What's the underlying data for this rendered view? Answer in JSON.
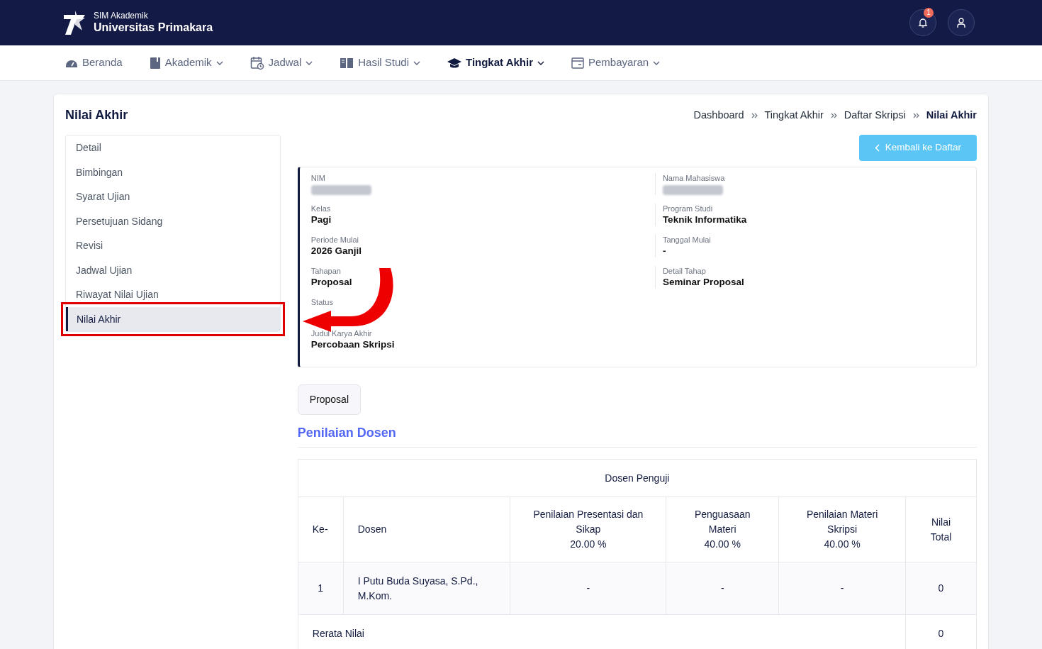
{
  "brand": {
    "subtitle": "SIM Akademik",
    "title": "Universitas Primakara"
  },
  "notifications": {
    "count": "1"
  },
  "menu": [
    {
      "label": "Beranda",
      "dropdown": false,
      "selected": false
    },
    {
      "label": "Akademik",
      "dropdown": true,
      "selected": false
    },
    {
      "label": "Jadwal",
      "dropdown": true,
      "selected": false
    },
    {
      "label": "Hasil Studi",
      "dropdown": true,
      "selected": false
    },
    {
      "label": "Tingkat Akhir",
      "dropdown": true,
      "selected": true
    },
    {
      "label": "Pembayaran",
      "dropdown": true,
      "selected": false
    }
  ],
  "page_title": "Nilai Akhir",
  "breadcrumb": [
    "Dashboard",
    "Tingkat Akhir",
    "Daftar Skripsi",
    "Nilai Akhir"
  ],
  "sidebar": {
    "items": [
      {
        "label": "Detail",
        "selected": false,
        "highlighted": false
      },
      {
        "label": "Bimbingan",
        "selected": false,
        "highlighted": false
      },
      {
        "label": "Syarat Ujian",
        "selected": false,
        "highlighted": false
      },
      {
        "label": "Persetujuan Sidang",
        "selected": false,
        "highlighted": false
      },
      {
        "label": "Revisi",
        "selected": false,
        "highlighted": false
      },
      {
        "label": "Jadwal Ujian",
        "selected": false,
        "highlighted": false
      },
      {
        "label": "Riwayat Nilai Ujian",
        "selected": false,
        "highlighted": false
      },
      {
        "label": "Nilai Akhir",
        "selected": true,
        "highlighted": true
      }
    ]
  },
  "back_button": "Kembali ke Daftar",
  "details": {
    "left": [
      {
        "label": "NIM",
        "redacted": true
      },
      {
        "label": "Kelas",
        "value": "Pagi"
      },
      {
        "label": "Periode Mulai",
        "value": "2026 Ganjil"
      },
      {
        "label": "Tahapan",
        "value": "Proposal"
      },
      {
        "label": "Status"
      },
      {
        "label": "Judul Karya Akhir",
        "value": "Percobaan Skripsi"
      }
    ],
    "right": [
      {
        "label": "Nama Mahasiswa",
        "redacted": true
      },
      {
        "label": "Program Studi",
        "value": "Teknik Informatika"
      },
      {
        "label": "Tanggal Mulai",
        "value": "-"
      },
      {
        "label": "Detail Tahap",
        "value": "Seminar Proposal"
      }
    ]
  },
  "annotation_arrow": true,
  "stage_tabs": [
    {
      "label": "Proposal",
      "selected": true
    }
  ],
  "section_title": "Penilaian Dosen",
  "table": {
    "group_header": "Dosen Penguji",
    "columns": [
      {
        "label": "Ke-"
      },
      {
        "label": "Dosen"
      },
      {
        "label": "Penilaian Presentasi dan Sikap",
        "weight": "20.00 %"
      },
      {
        "label": "Penguasaan Materi",
        "weight": "40.00 %"
      },
      {
        "label": "Penilaian Materi Skripsi",
        "weight": "40.00 %"
      },
      {
        "label": "Nilai Total"
      }
    ],
    "rows": [
      [
        "1",
        "I Putu Buda Suyasa, S.Pd., M.Kom.",
        "-",
        "-",
        "-",
        "0"
      ]
    ],
    "footer": {
      "label": "Rerata Nilai",
      "value": "0"
    }
  }
}
